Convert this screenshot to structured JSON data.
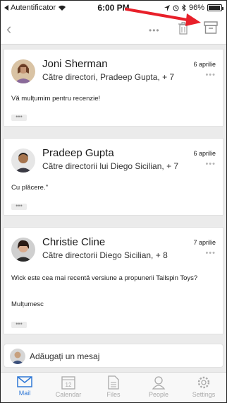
{
  "status": {
    "carrier": "Autentificator",
    "time": "6:00 PM",
    "battery": "96%",
    "battery_level": 0.96
  },
  "nav": {
    "more": "•••"
  },
  "messages": [
    {
      "sender": "Joni Sherman",
      "recipients": "Către directori, Pradeep Gupta, + 7",
      "date": "6 aprilie",
      "body": [
        "Vă mulțumim pentru recenzie!"
      ]
    },
    {
      "sender": "Pradeep Gupta",
      "recipients": "Către directorii lui Diego Sicilian, + 7",
      "date": "6 aprilie",
      "body": [
        "Cu plăcere.\""
      ]
    },
    {
      "sender": "Christie Cline",
      "recipients": "Către directorii Diego Sicilian, + 8",
      "date": "7 aprilie",
      "body": [
        "Wick este cea mai recentă versiune a propunerii Tailspin Toys?",
        "Mulțumesc"
      ]
    }
  ],
  "compose": {
    "placeholder": "Adăugați un mesaj"
  },
  "tabs": [
    {
      "label": "Mail",
      "active": true
    },
    {
      "label": "Calendar",
      "badge": "12"
    },
    {
      "label": "Files"
    },
    {
      "label": "People"
    },
    {
      "label": "Settings"
    }
  ],
  "colors": {
    "accent": "#2f78d6",
    "annotation_arrow": "#e8202a"
  }
}
